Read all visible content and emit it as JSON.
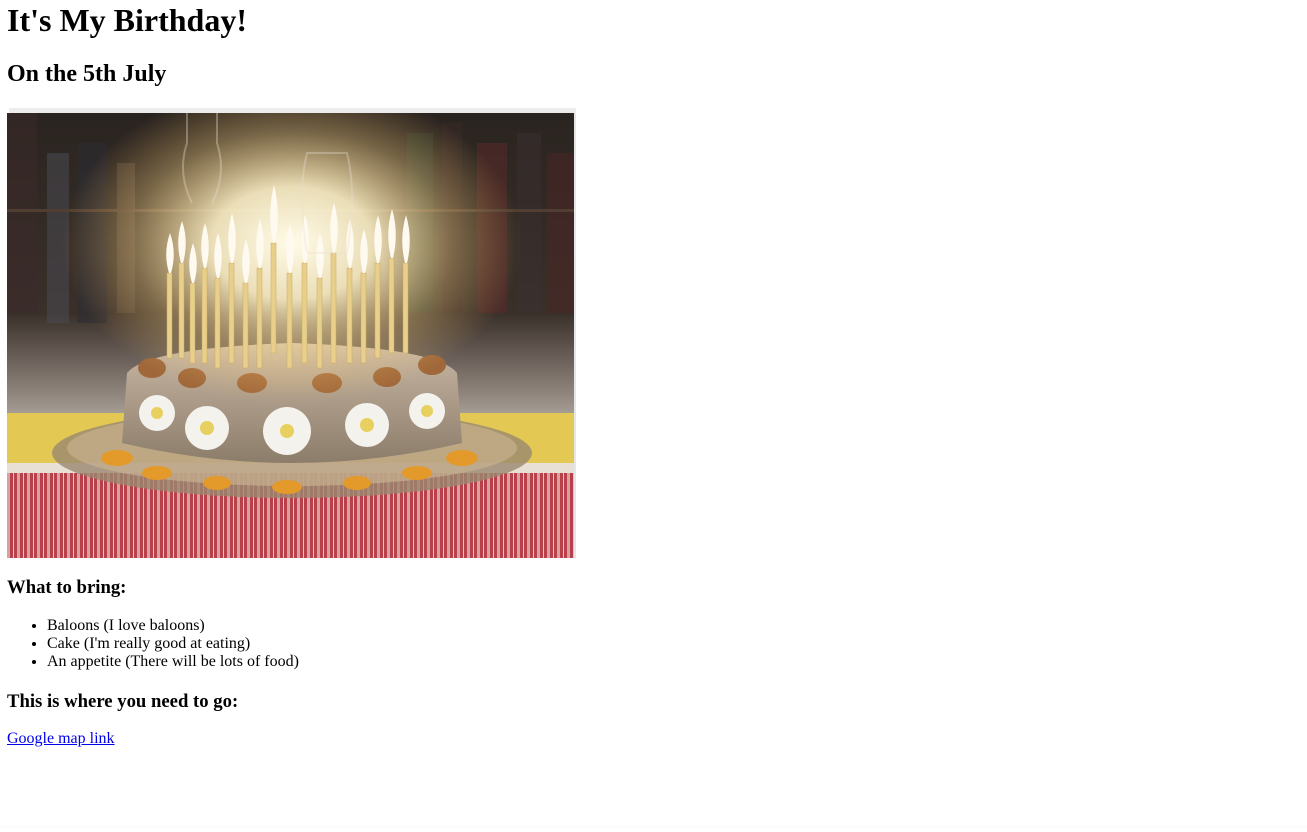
{
  "page": {
    "title": "It's My Birthday!",
    "date_line": "On the 5th July",
    "image_subject": "birthday-cake-with-candles",
    "bring_heading": "What to bring:",
    "bring_items": [
      "Baloons (I love baloons)",
      "Cake (I'm really good at eating)",
      "An appetite (There will be lots of food)"
    ],
    "go_heading": "This is where you need to go:",
    "map_link": "Google map link"
  },
  "colors": {
    "link": "#0000ee",
    "text": "#000000",
    "background": "#ffffff"
  }
}
